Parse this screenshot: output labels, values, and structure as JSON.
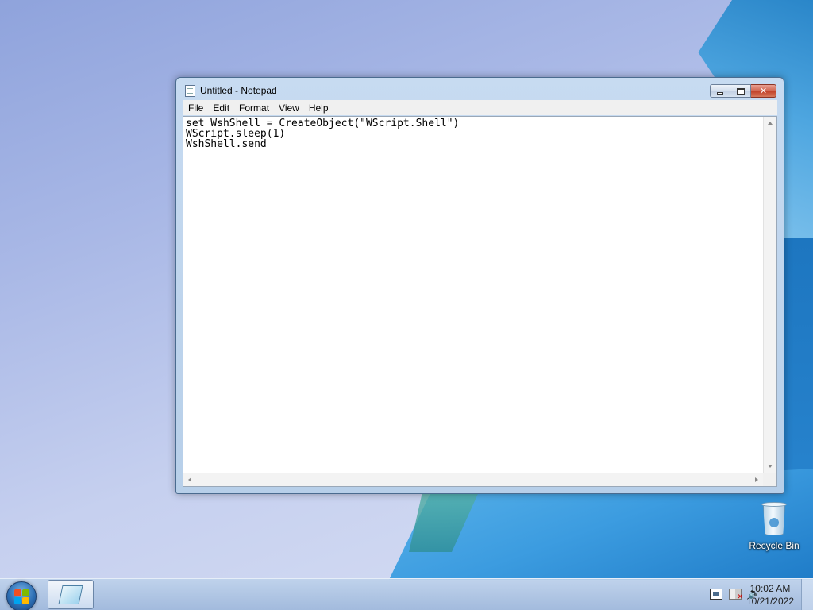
{
  "window": {
    "title": "Untitled - Notepad",
    "menu": [
      "File",
      "Edit",
      "Format",
      "View",
      "Help"
    ],
    "content": "set WshShell = CreateObject(\"WScript.Shell\")\nWScript.sleep(1)\nWshShell.send",
    "buttons": {
      "minimize": "minimize-icon",
      "maximize": "maximize-icon",
      "close": "close-icon"
    },
    "close_glyph": "✕"
  },
  "desktop": {
    "icons": [
      {
        "label": "Recycle Bin",
        "icon": "recycle-bin-icon"
      }
    ]
  },
  "taskbar": {
    "pinned": [
      {
        "app": "Notepad",
        "icon": "notepad-icon"
      }
    ],
    "tray_icons": [
      "network-icon",
      "action-center-icon",
      "volume-icon"
    ],
    "time": "10:02 AM",
    "date": "10/21/2022"
  },
  "colors": {
    "titlebar": "#c7dbf1",
    "close_button": "#c2442b",
    "taskbar": "#a9bfdf"
  }
}
